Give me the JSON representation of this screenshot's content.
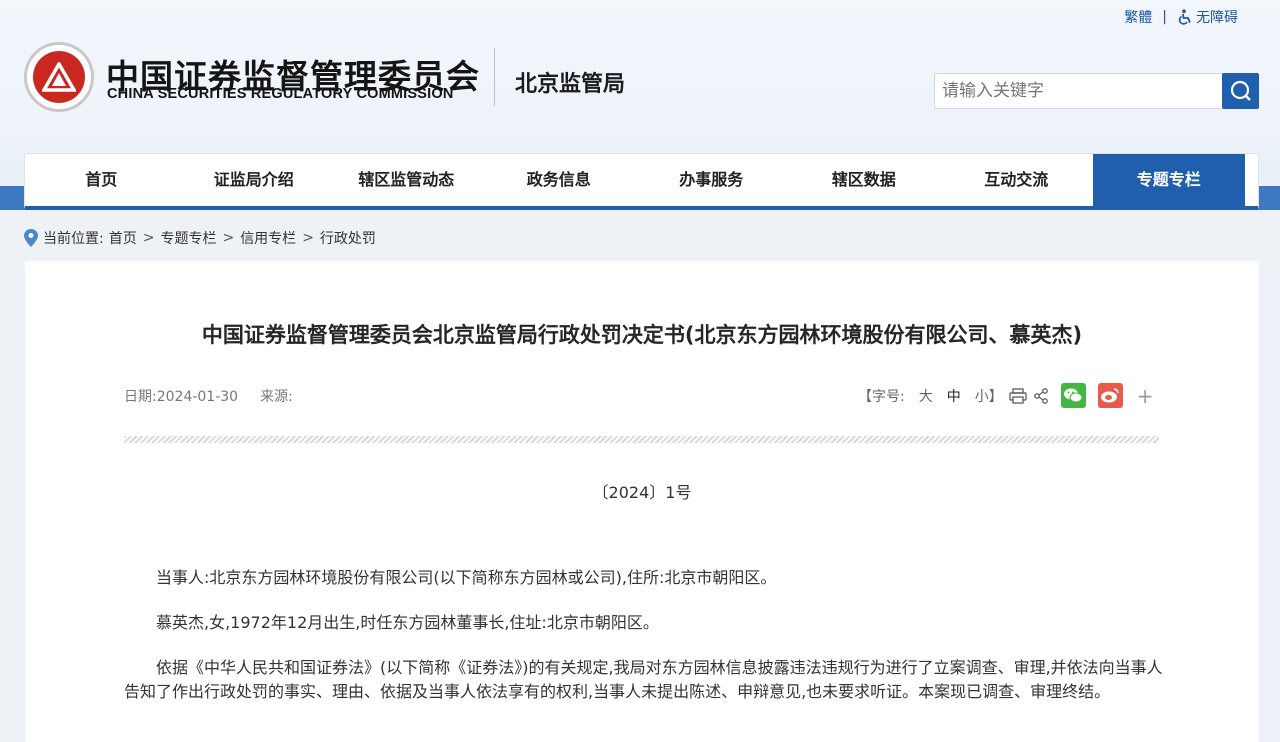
{
  "top_links": {
    "traditional": "繁體",
    "separator": "|",
    "accessibility": "无障碍"
  },
  "brand": {
    "name_cn": "中国证券监督管理委员会",
    "name_en": "CHINA SECURITIES REGULATORY COMMISSION",
    "bureau": "北京监管局"
  },
  "search": {
    "placeholder": "请输入关键字"
  },
  "nav": {
    "items": [
      {
        "label": "首页"
      },
      {
        "label": "证监局介绍"
      },
      {
        "label": "辖区监管动态"
      },
      {
        "label": "政务信息"
      },
      {
        "label": "办事服务"
      },
      {
        "label": "辖区数据"
      },
      {
        "label": "互动交流"
      },
      {
        "label": "专题专栏",
        "active": true
      }
    ]
  },
  "breadcrumb": {
    "prefix": "当前位置:",
    "items": [
      "首页",
      "专题专栏",
      "信用专栏",
      "行政处罚"
    ],
    "separator": ">"
  },
  "article": {
    "title": "中国证券监督管理委员会北京监管局行政处罚决定书(北京东方园林环境股份有限公司、慕英杰)",
    "date_label": "日期:2024-01-30",
    "source_label": "来源:",
    "font_size_label": "【字号:",
    "size_large": "大",
    "size_medium": "中",
    "size_small": "小】",
    "plus": "+",
    "doc_number": "〔2024〕1号",
    "paragraphs": [
      "当事人:北京东方园林环境股份有限公司(以下简称东方园林或公司),住所:北京市朝阳区。",
      "慕英杰,女,1972年12月出生,时任东方园林董事长,住址:北京市朝阳区。",
      "依据《中华人民共和国证券法》(以下简称《证券法》)的有关规定,我局对东方园林信息披露违法违规行为进行了立案调查、审理,并依法向当事人告知了作出行政处罚的事实、理由、依据及当事人依法享有的权利,当事人未提出陈述、申辩意见,也未要求听证。本案现已调查、审理终结。"
    ]
  },
  "colors": {
    "primary": "#1f5fae",
    "band": "#3f78c2",
    "wechat": "#43b644",
    "weibo": "#ea5a4b",
    "logo_red": "#c8281f"
  }
}
